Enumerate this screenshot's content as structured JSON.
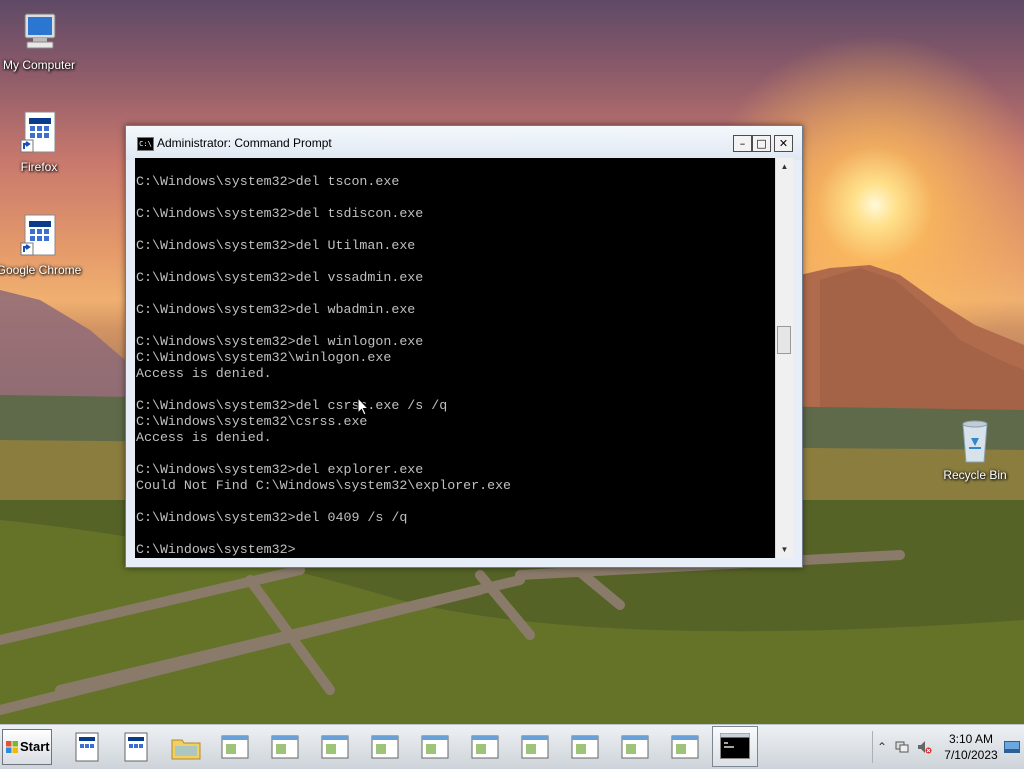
{
  "desktop": {
    "icons": [
      {
        "label": "My Computer"
      },
      {
        "label": "Firefox"
      },
      {
        "label": "Google Chrome"
      },
      {
        "label": "Recycle Bin"
      }
    ]
  },
  "window": {
    "title": "Administrator:  Command Prompt",
    "icon_text": "C:\\",
    "minimize_glyph": "–",
    "maximize_glyph": "□",
    "close_glyph": "✕",
    "console_text": "C:\\Windows\\system32>del tscon.exe\n\nC:\\Windows\\system32>del tsdiscon.exe\n\nC:\\Windows\\system32>del Utilman.exe\n\nC:\\Windows\\system32>del vssadmin.exe\n\nC:\\Windows\\system32>del wbadmin.exe\n\nC:\\Windows\\system32>del winlogon.exe\nC:\\Windows\\system32\\winlogon.exe\nAccess is denied.\n\nC:\\Windows\\system32>del csrss.exe /s /q\nC:\\Windows\\system32\\csrss.exe\nAccess is denied.\n\nC:\\Windows\\system32>del explorer.exe\nCould Not Find C:\\Windows\\system32\\explorer.exe\n\nC:\\Windows\\system32>del 0409 /s /q\n\nC:\\Windows\\system32>"
  },
  "taskbar": {
    "start_label": "Start",
    "clock_time": "3:10 AM",
    "clock_date": "7/10/2023",
    "tray_expand_glyph": "⌃"
  },
  "colors": {
    "console_bg": "#000000",
    "console_fg": "#c0c0c0"
  }
}
